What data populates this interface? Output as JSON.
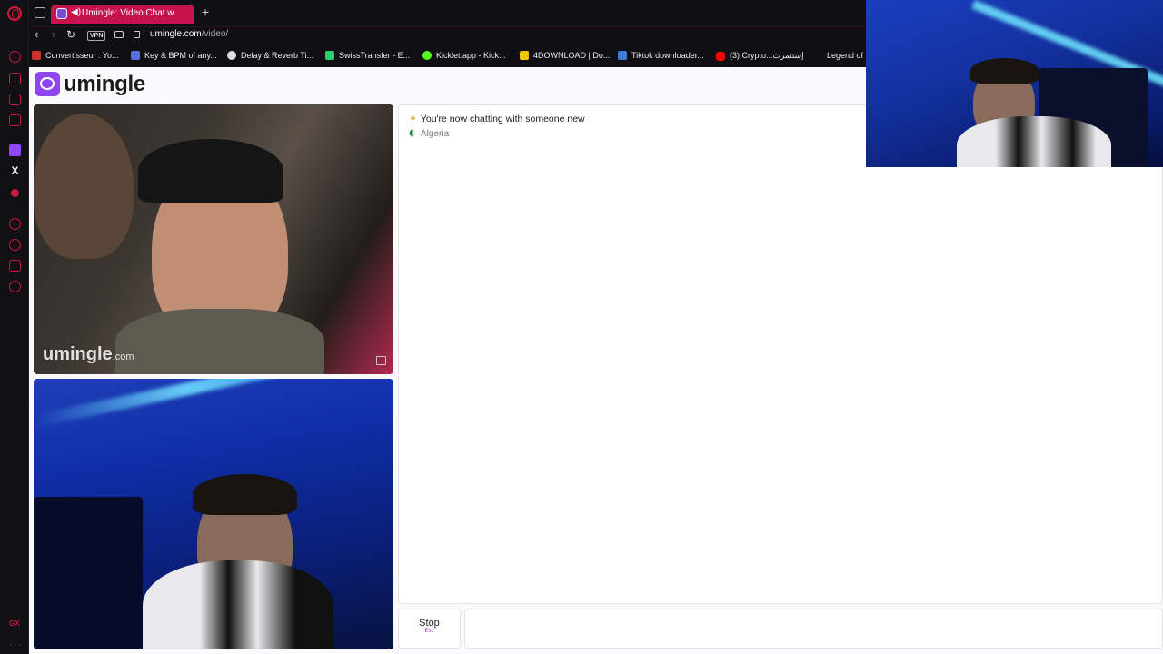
{
  "browser": {
    "tab": {
      "title": "Umingle: Video Chat w"
    },
    "address": {
      "domain": "umingle.com",
      "path": "/video/",
      "vpn_label": "VPN"
    },
    "bookmarks": [
      {
        "label": "Convertisseur : Yo...",
        "color": "#c0392b"
      },
      {
        "label": "Key & BPM of any...",
        "color": "#5b6ee1"
      },
      {
        "label": "Delay & Reverb Ti...",
        "color": "#dddddd"
      },
      {
        "label": "SwissTransfer - E...",
        "color": "#2ecc71"
      },
      {
        "label": "Kicklet.app - Kick...",
        "color": "#53fc18"
      },
      {
        "label": "4DOWNLOAD | Do...",
        "color": "#f1c40f"
      },
      {
        "label": "Tiktok downloader...",
        "color": "#3d7bd8"
      },
      {
        "label": "(3) Crypto...إستثمرت",
        "color": "#ff0000"
      },
      {
        "label": "Legend of",
        "color": "#0f0f14"
      }
    ],
    "sidebar_badge": "GX",
    "sidebar_more": "···"
  },
  "site": {
    "logo_text": "umingle",
    "watermark_main": "umingle",
    "watermark_suffix": ".com"
  },
  "chat": {
    "status_message": "You're now chatting with someone new",
    "country": "Algeria"
  },
  "controls": {
    "stop_label": "Stop",
    "stop_hint": "Esc",
    "message_placeholder": ""
  },
  "colors": {
    "brand": "#8f45f0",
    "opera_accent": "#c51a3c"
  }
}
